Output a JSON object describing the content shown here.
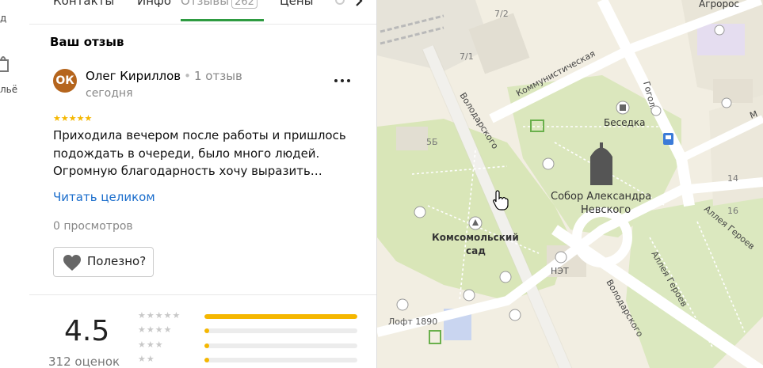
{
  "left_strip": {
    "top_text": "д",
    "bottom_text": "льё"
  },
  "tabs": [
    {
      "label": "Контакты"
    },
    {
      "label": "Инфо"
    },
    {
      "label": "Отзывы",
      "badge": "262",
      "active": true
    },
    {
      "label": "Цены"
    }
  ],
  "review_section": {
    "title": "Ваш отзыв",
    "avatar_initials": "ОК",
    "author": "Олег Кириллов",
    "author_reviews": "1 отзыв",
    "date": "сегодня",
    "stars": "★★★★★",
    "text": "Приходила вечером после работы и пришлось подождать в очереди, было много людей. Огромную благодарность хочу выразить…",
    "read_more": "Читать целиком",
    "views": "0 просмотров",
    "useful_label": "Полезно?",
    "more_icon": "more-dots-icon"
  },
  "rating_summary": {
    "value": "4.5",
    "count": "312 оценок",
    "distribution": [
      {
        "stars": "★★★★★",
        "fraction": 1.0
      },
      {
        "stars": "★★★★",
        "fraction": 0.03
      },
      {
        "stars": "★★★",
        "fraction": 0.03
      },
      {
        "stars": "★★",
        "fraction": 0.03
      }
    ]
  },
  "map_labels": {
    "agropros": "Агророс",
    "kommunisticheskaya": "Коммунистическая",
    "volodarskogo_1": "Володарского",
    "volodarskogo_2": "Володарского",
    "gogolya": "Гоголя",
    "gazebo": "Беседка",
    "cathedral_1": "Собор Александра",
    "cathedral_2": "Невского",
    "garden_1": "Комсомольский",
    "garden_2": "сад",
    "net": "НЭТ",
    "loft": "Лофт 1890",
    "alleya_1": "Аллея Героев",
    "alleya_2": "Аллея Героев",
    "m": "М",
    "b7_2": "7/2",
    "b7_1": "7/1",
    "b5b": "5Б",
    "b14": "14",
    "b16": "16"
  },
  "colors": {
    "accent_green": "#2e9b41",
    "link_blue": "#1a6dcc",
    "star_yellow": "#f5b700",
    "avatar_brown": "#b5651d"
  }
}
